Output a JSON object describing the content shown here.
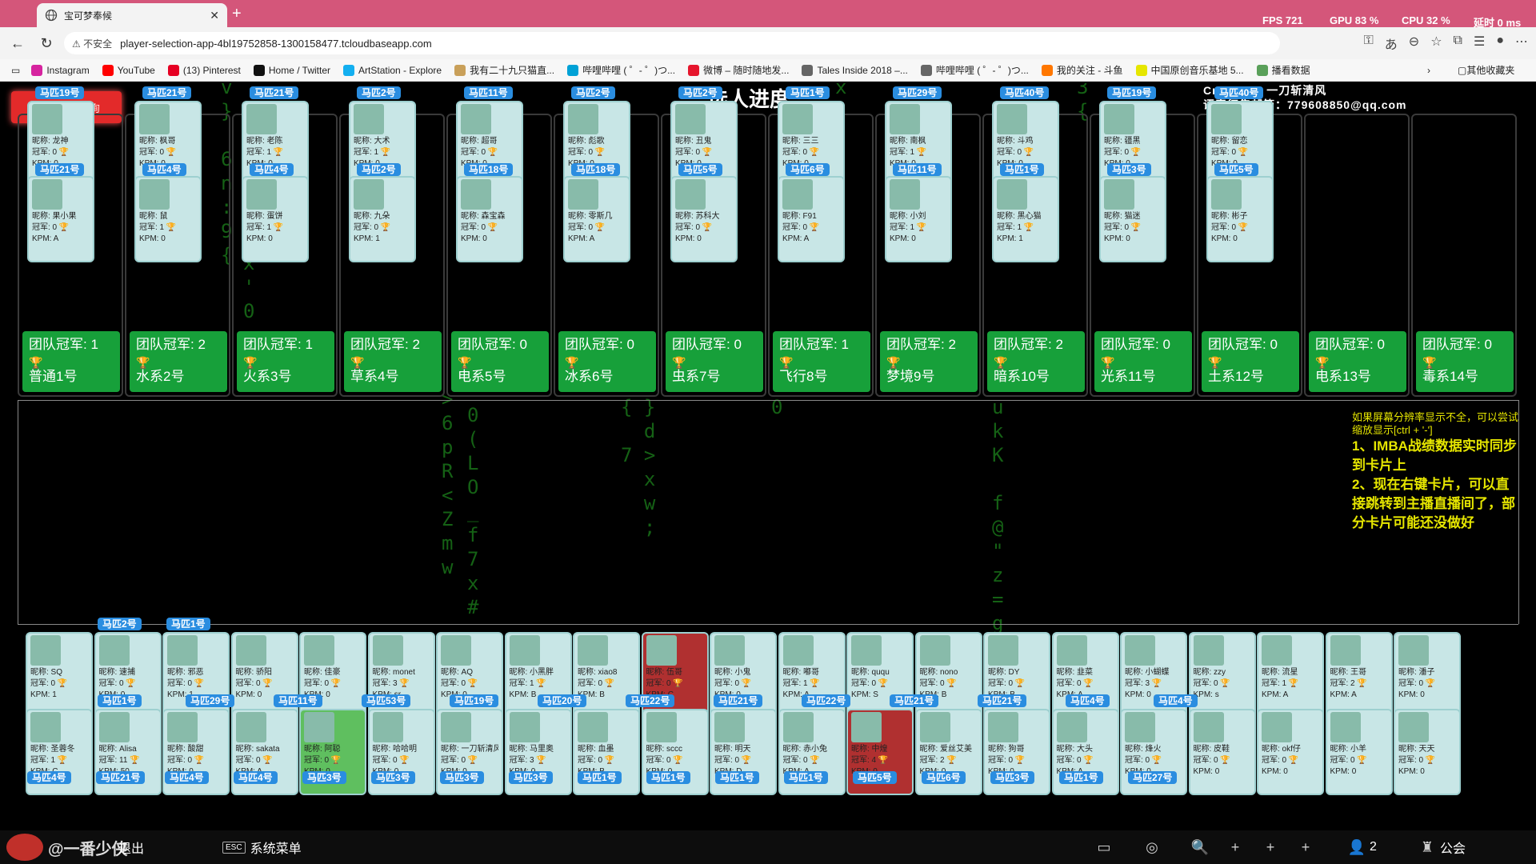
{
  "browser": {
    "tab_title": "宝可梦奉候",
    "url": "player-selection-app-4bl19752858-1300158477.tcloudbaseapp.com",
    "insecure_label": "不安全",
    "perf": {
      "fps": "FPS 721",
      "gpu": "GPU 83 %",
      "cpu": "CPU 32 %",
      "latency": "延时 0 ms"
    },
    "bookmarks": [
      {
        "label": "Instagram",
        "color": "#d6249f"
      },
      {
        "label": "YouTube",
        "color": "#ff0000"
      },
      {
        "label": "(13) Pinterest",
        "color": "#e60023"
      },
      {
        "label": "Home / Twitter",
        "color": "#111111"
      },
      {
        "label": "ArtStation - Explore",
        "color": "#13aff0"
      },
      {
        "label": "我有二十九只猫直...",
        "color": "#c9a05a"
      },
      {
        "label": "哔哩哔哩 ( ゜- ゜)つ...",
        "color": "#00a1d6"
      },
      {
        "label": "微博 – 随时随地发...",
        "color": "#e6162d"
      },
      {
        "label": "Tales Inside 2018 –...",
        "color": "#666666"
      },
      {
        "label": "哔哩哔哩 ( ゜- ゜)つ...",
        "color": "#666666"
      },
      {
        "label": "我的关注 - 斗鱼",
        "color": "#ff7700"
      },
      {
        "label": "中国原创音乐基地 5...",
        "color": "#e6e600"
      },
      {
        "label": "播看数据",
        "color": "#5aa05a"
      }
    ],
    "other_bookmarks": "其他收藏夹"
  },
  "page": {
    "imba_button": "IMBA战绩查询",
    "progress_title": "选人进度:",
    "credit_line1": "Create By 一刀斩清风",
    "credit_line2": "语音征集邮箱：779608850@qq.com",
    "teams": [
      {
        "name": "普通1号",
        "champ": "团队冠军: 1"
      },
      {
        "name": "水系2号",
        "champ": "团队冠军: 2"
      },
      {
        "name": "火系3号",
        "champ": "团队冠军: 1"
      },
      {
        "name": "草系4号",
        "champ": "团队冠军: 2"
      },
      {
        "name": "电系5号",
        "champ": "团队冠军: 0"
      },
      {
        "name": "冰系6号",
        "champ": "团队冠军: 0"
      },
      {
        "name": "虫系7号",
        "champ": "团队冠军: 0"
      },
      {
        "name": "飞行8号",
        "champ": "团队冠军: 1"
      },
      {
        "name": "梦境9号",
        "champ": "团队冠军: 2"
      },
      {
        "name": "暗系10号",
        "champ": "团队冠军: 2"
      },
      {
        "name": "光系11号",
        "champ": "团队冠军: 0"
      },
      {
        "name": "土系12号",
        "champ": "团队冠军: 0"
      },
      {
        "name": "电系13号",
        "champ": "团队冠军: 0"
      },
      {
        "name": "毒系14号",
        "champ": "团队冠军: 0"
      }
    ],
    "team_cards": [
      {
        "slot": "马匹19号",
        "nick": "昵称: 龙神",
        "crown": "冠军: 0",
        "kpm": "KPM: 0"
      },
      {
        "slot": "马匹21号",
        "nick": "昵称: 枫哥",
        "crown": "冠军: 0",
        "kpm": "KPM: 0"
      },
      {
        "slot": "马匹21号",
        "nick": "昵称: 老陈",
        "crown": "冠军: 1",
        "kpm": "KPM: 0"
      },
      {
        "slot": "马匹2号",
        "nick": "昵称: 大术",
        "crown": "冠军: 1",
        "kpm": "KPM: 0"
      },
      {
        "slot": "马匹11号",
        "nick": "昵称: 超哥",
        "crown": "冠军: 0",
        "kpm": "KPM: 0"
      },
      {
        "slot": "马匹2号",
        "nick": "昵称: 彪歌",
        "crown": "冠军: 0",
        "kpm": "KPM: 0"
      },
      {
        "slot": "马匹2号",
        "nick": "昵称: 丑鬼",
        "crown": "冠军: 0",
        "kpm": "KPM: 0"
      },
      {
        "slot": "马匹1号",
        "nick": "昵称: 三三",
        "crown": "冠军: 0",
        "kpm": "KPM: 0"
      },
      {
        "slot": "马匹29号",
        "nick": "昵称: 南枫",
        "crown": "冠军: 1",
        "kpm": "KPM: 0"
      },
      {
        "slot": "马匹40号",
        "nick": "昵称: 斗鸡",
        "crown": "冠军: 0",
        "kpm": "KPM: 0"
      },
      {
        "slot": "马匹19号",
        "nick": "昵称: 疆黑",
        "crown": "冠军: 0",
        "kpm": "KPM: 0"
      },
      {
        "slot": "马匹40号",
        "nick": "昵称: 留恋",
        "crown": "冠军: 0",
        "kpm": "KPM: 0"
      },
      {
        "slot": "马匹21号",
        "nick": "昵称: 果小果",
        "crown": "冠军: 0",
        "kpm": "KPM: A"
      },
      {
        "slot": "马匹4号",
        "nick": "昵称: 鼠",
        "crown": "冠军: 1",
        "kpm": "KPM: 0"
      },
      {
        "slot": "马匹4号",
        "nick": "昵称: 蛋饼",
        "crown": "冠军: 1",
        "kpm": "KPM: 0"
      },
      {
        "slot": "马匹2号",
        "nick": "昵称: 九朵",
        "crown": "冠军: 0",
        "kpm": "KPM: 1"
      },
      {
        "slot": "马匹18号",
        "nick": "昵称: 森宝森",
        "crown": "冠军: 0",
        "kpm": "KPM: 0"
      },
      {
        "slot": "马匹18号",
        "nick": "昵称: 零斯几",
        "crown": "冠军: 0",
        "kpm": "KPM: A"
      },
      {
        "slot": "马匹5号",
        "nick": "昵称: 苏科大",
        "crown": "冠军: 0",
        "kpm": "KPM: 0"
      },
      {
        "slot": "马匹6号",
        "nick": "昵称: F91",
        "crown": "冠军: 0",
        "kpm": "KPM: A"
      },
      {
        "slot": "马匹11号",
        "nick": "昵称: 小刘",
        "crown": "冠军: 1",
        "kpm": "KPM: 0"
      },
      {
        "slot": "马匹1号",
        "nick": "昵称: 黑心猫",
        "crown": "冠军: 1",
        "kpm": "KPM: 1"
      },
      {
        "slot": "马匹3号",
        "nick": "昵称: 猫迷",
        "crown": "冠军: 0",
        "kpm": "KPM: 0"
      },
      {
        "slot": "马匹5号",
        "nick": "昵称: 彬子",
        "crown": "冠军: 0",
        "kpm": "KPM: 0"
      }
    ],
    "tips": {
      "small": "如果屏幕分辨率显示不全，可以尝试缩放显示[ctrl + '-']",
      "line1": "1、IMBA战绩数据实时同步到卡片上",
      "line2": "2、现在右键卡片，可以直接跳转到主播直播间了，部分卡片可能还没做好"
    },
    "pool_row1": [
      {
        "nick": "昵称: SQ",
        "crown": "冠军: 0",
        "kpm": "KPM: 1"
      },
      {
        "nick": "昵称: 速捕",
        "crown": "冠军: 0",
        "kpm": "KPM: 0"
      },
      {
        "nick": "昵称: 邪恶",
        "crown": "冠军: 0",
        "kpm": "KPM: 1"
      },
      {
        "nick": "昵称: 骄阳",
        "crown": "冠军: 0",
        "kpm": "KPM: 0"
      },
      {
        "nick": "昵称: 佳豪",
        "crown": "冠军: 0",
        "kpm": "KPM: 0"
      },
      {
        "nick": "昵称: monet",
        "crown": "冠军: 3",
        "kpm": "KPM: sr"
      },
      {
        "nick": "昵称: AQ",
        "crown": "冠军: 0",
        "kpm": "KPM: 0"
      },
      {
        "nick": "昵称: 小黑胖",
        "crown": "冠军: 1",
        "kpm": "KPM: B"
      },
      {
        "nick": "昵称: xiao8",
        "crown": "冠军: 0",
        "kpm": "KPM: B"
      },
      {
        "nick": "昵称: 伍哥",
        "crown": "冠军: 0",
        "kpm": "KPM: C"
      },
      {
        "nick": "昵称: 小鬼",
        "crown": "冠军: 0",
        "kpm": "KPM: 0"
      },
      {
        "nick": "昵称: 嘟哥",
        "crown": "冠军: 1",
        "kpm": "KPM: A"
      },
      {
        "nick": "昵称: ququ",
        "crown": "冠军: 0",
        "kpm": "KPM: S"
      },
      {
        "nick": "昵称: nono",
        "crown": "冠军: 0",
        "kpm": "KPM: B"
      },
      {
        "nick": "昵称: DY",
        "crown": "冠军: 0",
        "kpm": "KPM: B"
      },
      {
        "nick": "昵称: 韭菜",
        "crown": "冠军: 0",
        "kpm": "KPM: A"
      },
      {
        "nick": "昵称: 小蝴蝶",
        "crown": "冠军: 3",
        "kpm": "KPM: 0"
      },
      {
        "nick": "昵称: zzy",
        "crown": "冠军: 0",
        "kpm": "KPM: s"
      },
      {
        "nick": "昵称: 流星",
        "crown": "冠军: 1",
        "kpm": "KPM: A"
      },
      {
        "nick": "昵称: 王哥",
        "crown": "冠军: 2",
        "kpm": "KPM: A"
      },
      {
        "nick": "昵称: 潘子",
        "crown": "冠军: 0",
        "kpm": "KPM: 0"
      }
    ],
    "pool_row2": [
      {
        "nick": "昵称: 圣蓉冬",
        "crown": "冠军: 1",
        "kpm": "KPM: C"
      },
      {
        "nick": "昵称: Alisa",
        "crown": "冠军: 11",
        "kpm": "KPM: 50"
      },
      {
        "nick": "昵称: 酸甜",
        "crown": "冠军: 0",
        "kpm": "KPM: 0"
      },
      {
        "nick": "昵称: sakata",
        "crown": "冠军: 0",
        "kpm": "KPM: A"
      },
      {
        "nick": "昵称: 阿聪",
        "crown": "冠军: 0",
        "kpm": "KPM: 0"
      },
      {
        "nick": "昵称: 哈哈明",
        "crown": "冠军: 0",
        "kpm": "KPM: 0"
      },
      {
        "nick": "昵称: 一刀斩清风",
        "crown": "冠军: 0",
        "kpm": "KPM: 0"
      },
      {
        "nick": "昵称: 马里奥",
        "crown": "冠军: 3",
        "kpm": "KPM: 0"
      },
      {
        "nick": "昵称: 血墨",
        "crown": "冠军: 0",
        "kpm": "KPM: B"
      },
      {
        "nick": "昵称: sccc",
        "crown": "冠军: 0",
        "kpm": "KPM: 0"
      },
      {
        "nick": "昵称: 明天",
        "crown": "冠军: 0",
        "kpm": "KPM: D"
      },
      {
        "nick": "昵称: 赤小兔",
        "crown": "冠军: 0",
        "kpm": "KPM: A"
      },
      {
        "nick": "昵称: 中煌",
        "crown": "冠军: 4",
        "kpm": "KPM: 0"
      },
      {
        "nick": "昵称: 爱丝艾美",
        "crown": "冠军: 2",
        "kpm": "KPM: 0"
      },
      {
        "nick": "昵称: 狗哥",
        "crown": "冠军: 0",
        "kpm": "KPM: 0"
      },
      {
        "nick": "昵称: 大头",
        "crown": "冠军: 0",
        "kpm": "KPM: A"
      },
      {
        "nick": "昵称: 烽火",
        "crown": "冠军: 0",
        "kpm": "KPM: 0"
      },
      {
        "nick": "昵称: 皮鞋",
        "crown": "冠军: 0",
        "kpm": "KPM: 0"
      },
      {
        "nick": "昵称: okf仔",
        "crown": "冠军: 0",
        "kpm": "KPM: 0"
      },
      {
        "nick": "昵称: 小羊",
        "crown": "冠军: 0",
        "kpm": "KPM: 0"
      },
      {
        "nick": "昵称: 天天",
        "crown": "冠军: 0",
        "kpm": "KPM: 0"
      }
    ],
    "pool_slots_row1": [
      "马匹2号",
      "马匹1号"
    ],
    "pool_slots_row2": [
      "马匹1号",
      "马匹29号",
      "马匹11号",
      "马匹53号",
      "马匹19号",
      "马匹20号",
      "马匹22号",
      "马匹21号",
      "马匹22号",
      "马匹21号",
      "马匹21号",
      "马匹4号",
      "马匹4号"
    ],
    "pool_slots_row3": [
      "马匹4号",
      "马匹21号",
      "马匹4号",
      "马匹4号",
      "马匹3号",
      "马匹3号",
      "马匹3号",
      "马匹3号",
      "马匹1号",
      "马匹1号",
      "马匹1号",
      "马匹1号",
      "马匹5号",
      "马匹6号",
      "马匹3号",
      "马匹1号",
      "马匹27号"
    ]
  },
  "taskbar": {
    "streamer": "@一番少侠",
    "exit": "退出",
    "esc": "ESC",
    "menu": "系统菜单",
    "count": "2",
    "guild": "公会"
  }
}
